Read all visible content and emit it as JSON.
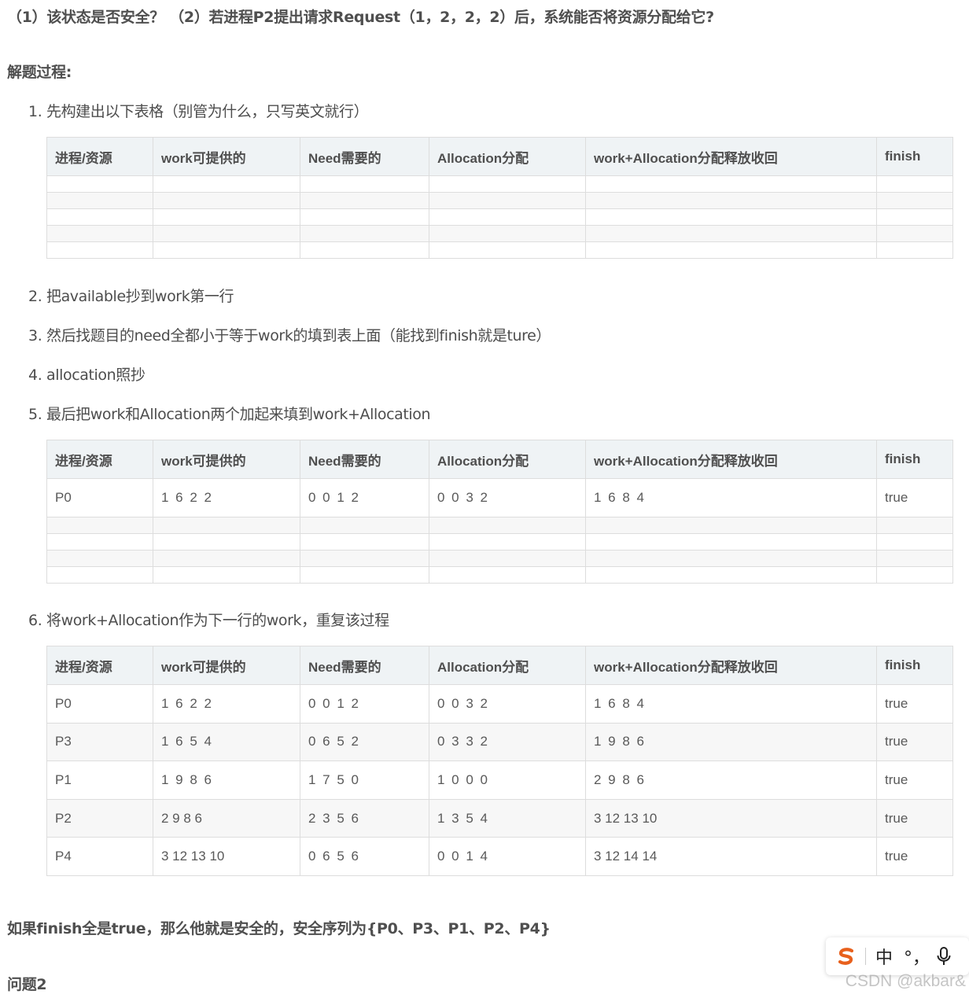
{
  "question_line": "（1）该状态是否安全？ （2）若进程P2提出请求Request（1，2，2，2）后，系统能否将资源分配给它?",
  "process_heading": "解题过程:",
  "steps": [
    "1. 先构建出以下表格（别管为什么，只写英文就行）",
    "2. 把available抄到work第一行",
    "3. 然后找题目的need全都小于等于work的填到表上面（能找到finish就是ture）",
    "4. allocation照抄",
    "5. 最后把work和Allocation两个加起来填到work+Allocation",
    "6. 将work+Allocation作为下一行的work，重复该过程"
  ],
  "table_headers": [
    "进程/资源",
    "work可提供的",
    "Need需要的",
    "Allocation分配",
    "work+Allocation分配释放收回",
    "finish"
  ],
  "table2_rows": [
    [
      "P0",
      "1 6 2 2",
      "0 0 1 2",
      "0 0 3 2",
      "1 6 8 4",
      "true"
    ]
  ],
  "table3_rows": [
    [
      "P0",
      "1 6 2 2",
      "0 0 1 2",
      "0 0 3 2",
      "1 6 8 4",
      "true"
    ],
    [
      "P3",
      "1 6 5 4",
      "0 6 5 2",
      "0 3 3 2",
      "1 9 8 6",
      "true"
    ],
    [
      "P1",
      "1 9 8 6",
      "1 7 5 0",
      "1 0 0 0",
      "2 9 8 6",
      "true"
    ],
    [
      "P2",
      "2 9 8 6",
      "2 3 5 6",
      "1 3 5 4",
      "3 12 13 10",
      "true"
    ],
    [
      "P4",
      "3 12 13 10",
      "0 6 5 6",
      "0 0 1 4",
      "3 12 14 14",
      "true"
    ]
  ],
  "conclusion": "如果finish全是true，那么他就是安全的，安全序列为{P0、P3、P1、P2、P4}",
  "question2_heading": "问题2",
  "ime_toolbar": {
    "chinese_mode": "中",
    "punct_mode": "°，",
    "logo_icon": "sogou-s-icon",
    "mic_icon": "microphone-icon",
    "logo_color": "#e8601c"
  },
  "watermark": "CSDN @akbar&"
}
